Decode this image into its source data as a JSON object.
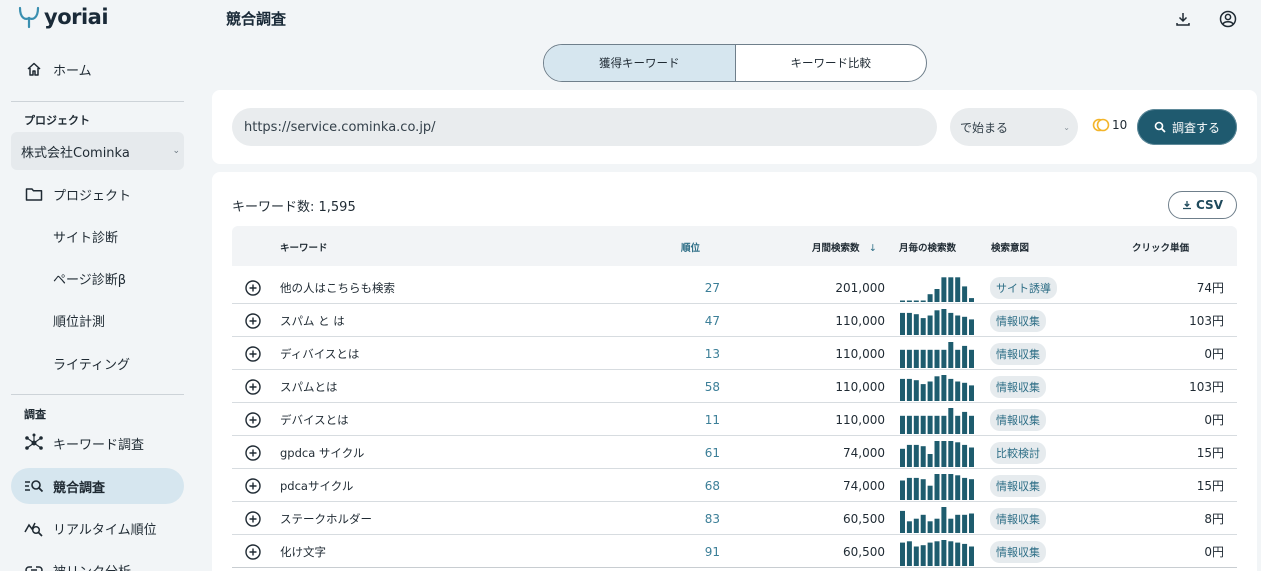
{
  "app": {
    "logo_text": "yoriai"
  },
  "sidebar": {
    "home_label": "ホーム",
    "project_section": "プロジェクト",
    "project_selected": "株式会社Cominka",
    "items": [
      {
        "label": "プロジェクト"
      },
      {
        "label": "サイト診断"
      },
      {
        "label": "ページ診断β"
      },
      {
        "label": "順位計測"
      },
      {
        "label": "ライティング"
      }
    ],
    "research_section": "調査",
    "research_items": [
      {
        "label": "キーワード調査"
      },
      {
        "label": "競合調査"
      },
      {
        "label": "リアルタイム順位"
      },
      {
        "label": "被リンク分析"
      }
    ]
  },
  "header": {
    "title": "競合調査"
  },
  "tabs": [
    {
      "label": "獲得キーワード",
      "active": true
    },
    {
      "label": "キーワード比較",
      "active": false
    }
  ],
  "search": {
    "url_value": "https://service.cominka.co.jp/",
    "match_value": "で始まる",
    "credits": "10",
    "submit_label": "調査する"
  },
  "results": {
    "count_label": "キーワード数: 1,595",
    "csv_label": "CSV",
    "columns": {
      "keyword": "キーワード",
      "rank": "順位",
      "volume": "月間検索数",
      "monthly": "月毎の検索数",
      "intent": "検索意図",
      "cpc": "クリック単価"
    },
    "rows": [
      {
        "keyword": "他の人はこちらも検索",
        "rank": "27",
        "volume": "201,000",
        "intent": "サイト誘導",
        "cpc": "74円",
        "trend": [
          0.05,
          0.05,
          0.05,
          0.05,
          0.3,
          0.5,
          0.95,
          0.95,
          0.95,
          0.6,
          0.15
        ]
      },
      {
        "keyword": "スパム と は",
        "rank": "47",
        "volume": "110,000",
        "intent": "情報収集",
        "cpc": "103円",
        "trend": [
          0.85,
          0.85,
          0.8,
          0.65,
          0.75,
          0.95,
          1.0,
          0.85,
          0.75,
          0.7,
          0.6
        ]
      },
      {
        "keyword": "ディバイスとは",
        "rank": "13",
        "volume": "110,000",
        "intent": "情報収集",
        "cpc": "0円",
        "trend": [
          0.7,
          0.7,
          0.7,
          0.7,
          0.7,
          0.7,
          0.7,
          1.0,
          0.7,
          0.85,
          0.7
        ]
      },
      {
        "keyword": "スパムとは",
        "rank": "58",
        "volume": "110,000",
        "intent": "情報収集",
        "cpc": "103円",
        "trend": [
          0.85,
          0.85,
          0.8,
          0.65,
          0.75,
          0.95,
          1.0,
          0.85,
          0.75,
          0.7,
          0.6
        ]
      },
      {
        "keyword": "デバイスとは",
        "rank": "11",
        "volume": "110,000",
        "intent": "情報収集",
        "cpc": "0円",
        "trend": [
          0.7,
          0.7,
          0.7,
          0.7,
          0.7,
          0.7,
          0.7,
          1.0,
          0.7,
          0.85,
          0.7
        ]
      },
      {
        "keyword": "gpdca サイクル",
        "rank": "61",
        "volume": "74,000",
        "intent": "比較検討",
        "cpc": "15円",
        "trend": [
          0.7,
          0.85,
          0.85,
          0.8,
          0.5,
          1.0,
          1.0,
          1.0,
          0.95,
          0.85,
          0.75
        ]
      },
      {
        "keyword": "pdcaサイクル",
        "rank": "68",
        "volume": "74,000",
        "intent": "情報収集",
        "cpc": "15円",
        "trend": [
          0.75,
          0.85,
          0.85,
          0.8,
          0.55,
          1.0,
          1.0,
          1.0,
          0.95,
          0.85,
          0.8
        ]
      },
      {
        "keyword": "ステークホルダー",
        "rank": "83",
        "volume": "60,500",
        "intent": "情報収集",
        "cpc": "8円",
        "trend": [
          0.85,
          0.45,
          0.55,
          0.7,
          0.45,
          0.55,
          1.0,
          0.55,
          0.7,
          0.7,
          0.75
        ]
      },
      {
        "keyword": "化け文字",
        "rank": "91",
        "volume": "60,500",
        "intent": "情報収集",
        "cpc": "0円",
        "trend": [
          0.9,
          0.95,
          0.75,
          0.8,
          0.9,
          0.95,
          1.0,
          0.95,
          0.9,
          0.85,
          0.75
        ]
      }
    ]
  },
  "colors": {
    "accent": "#1f5a6f",
    "active_bg": "#d6e6ef",
    "bar": "#1e5c6e",
    "rank_text": "#3c7f98"
  }
}
